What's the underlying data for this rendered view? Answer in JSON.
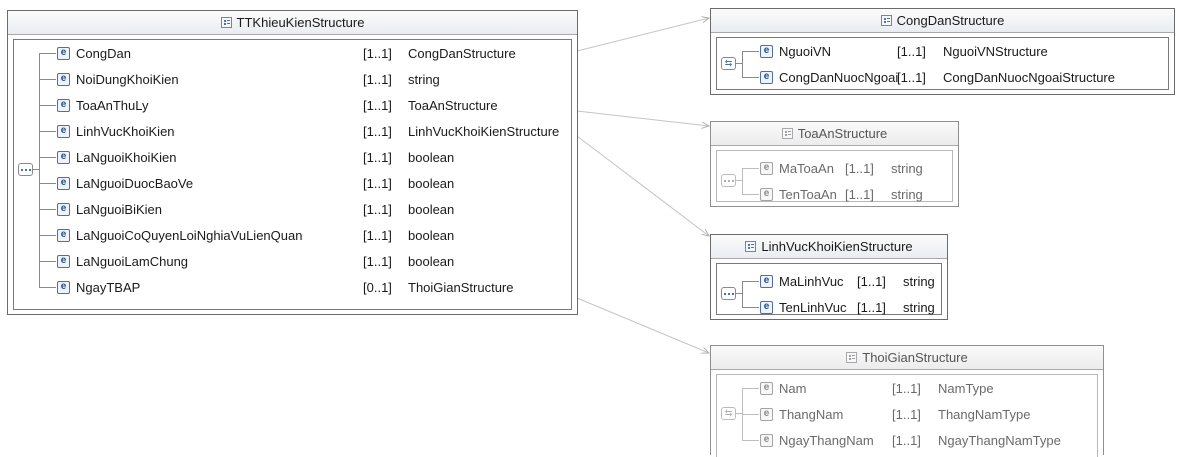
{
  "main": {
    "title": "TTKhieuKienStructure",
    "elements": [
      {
        "name": "CongDan",
        "card": "[1..1]",
        "type": "CongDanStructure"
      },
      {
        "name": "NoiDungKhoiKien",
        "card": "[1..1]",
        "type": "string"
      },
      {
        "name": "ToaAnThuLy",
        "card": "[1..1]",
        "type": "ToaAnStructure"
      },
      {
        "name": "LinhVucKhoiKien",
        "card": "[1..1]",
        "type": "LinhVucKhoiKienStructure"
      },
      {
        "name": "LaNguoiKhoiKien",
        "card": "[1..1]",
        "type": "boolean"
      },
      {
        "name": "LaNguoiDuocBaoVe",
        "card": "[1..1]",
        "type": "boolean"
      },
      {
        "name": "LaNguoiBiKien",
        "card": "[1..1]",
        "type": "boolean"
      },
      {
        "name": "LaNguoiCoQuyenLoiNghiaVuLienQuan",
        "card": "[1..1]",
        "type": "boolean"
      },
      {
        "name": "LaNguoiLamChung",
        "card": "[1..1]",
        "type": "boolean"
      },
      {
        "name": "NgayTBAP",
        "card": "[0..1]",
        "type": "ThoiGianStructure"
      }
    ]
  },
  "congdan": {
    "title": "CongDanStructure",
    "elements": [
      {
        "name": "NguoiVN",
        "card": "[1..1]",
        "type": "NguoiVNStructure"
      },
      {
        "name": "CongDanNuocNgoai",
        "card": "[1..1]",
        "type": "CongDanNuocNgoaiStructure"
      }
    ]
  },
  "toaan": {
    "title": "ToaAnStructure",
    "elements": [
      {
        "name": "MaToaAn",
        "card": "[1..1]",
        "type": "string"
      },
      {
        "name": "TenToaAn",
        "card": "[1..1]",
        "type": "string"
      }
    ]
  },
  "linhvuc": {
    "title": "LinhVucKhoiKienStructure",
    "elements": [
      {
        "name": "MaLinhVuc",
        "card": "[1..1]",
        "type": "string"
      },
      {
        "name": "TenLinhVuc",
        "card": "[1..1]",
        "type": "string"
      }
    ]
  },
  "thoigian": {
    "title": "ThoiGianStructure",
    "elements": [
      {
        "name": "Nam",
        "card": "[1..1]",
        "type": "NamType"
      },
      {
        "name": "ThangNam",
        "card": "[1..1]",
        "type": "ThangNamType"
      },
      {
        "name": "NgayThangNam",
        "card": "[1..1]",
        "type": "NgayThangNamType"
      }
    ]
  },
  "icons": {
    "element": "e",
    "structure": "complex-type-icon",
    "sequence": "sequence-compositor-icon",
    "choice": "choice-compositor-icon"
  },
  "colors": {
    "border": "#8f8f8f",
    "accent": "#4a73b0",
    "connector": "#bdbdbd"
  }
}
